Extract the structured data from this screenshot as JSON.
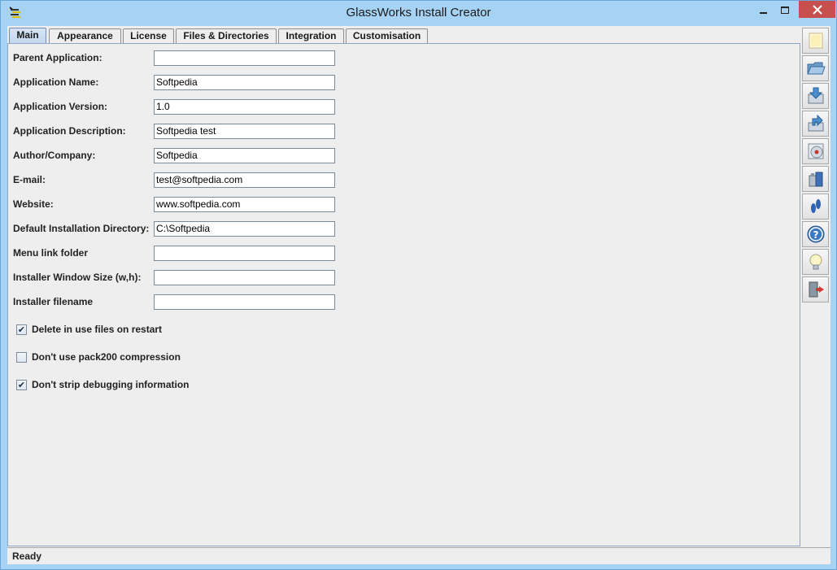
{
  "window": {
    "title": "GlassWorks Install Creator",
    "close_color": "#c7504f"
  },
  "tabs": [
    {
      "label": "Main",
      "active": true
    },
    {
      "label": "Appearance",
      "active": false
    },
    {
      "label": "License",
      "active": false
    },
    {
      "label": "Files & Directories",
      "active": false
    },
    {
      "label": "Integration",
      "active": false
    },
    {
      "label": "Customisation",
      "active": false
    }
  ],
  "fields": [
    {
      "label": "Parent Application:",
      "value": ""
    },
    {
      "label": "Application Name:",
      "value": "Softpedia"
    },
    {
      "label": "Application Version:",
      "value": "1.0"
    },
    {
      "label": "Application Description:",
      "value": "Softpedia test"
    },
    {
      "label": "Author/Company:",
      "value": "Softpedia"
    },
    {
      "label": "E-mail:",
      "value": "test@softpedia.com"
    },
    {
      "label": "Website:",
      "value": "www.softpedia.com"
    },
    {
      "label": "Default Installation Directory:",
      "value": "C:\\Softpedia"
    },
    {
      "label": "Menu link folder",
      "value": ""
    },
    {
      "label": "Installer Window Size (w,h):",
      "value": ""
    },
    {
      "label": "Installer filename",
      "value": ""
    }
  ],
  "checkboxes": [
    {
      "label": "Delete in use files on restart",
      "checked": true
    },
    {
      "label": "Don't use pack200 compression",
      "checked": false
    },
    {
      "label": "Don't strip debugging information",
      "checked": true
    }
  ],
  "toolbar_icons": [
    "new-document-icon",
    "open-folder-icon",
    "save-icon",
    "save-as-icon",
    "build-disc-icon",
    "package-icon",
    "footprints-icon",
    "help-icon",
    "tip-lightbulb-icon",
    "exit-icon"
  ],
  "status": {
    "text": "Ready"
  }
}
